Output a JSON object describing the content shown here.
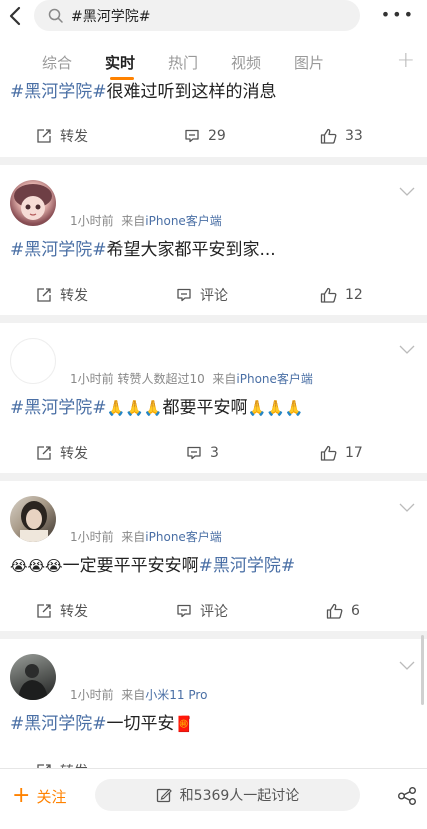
{
  "search": {
    "query": "#黑河学院#"
  },
  "tabs": [
    {
      "label": "综合"
    },
    {
      "label": "实时"
    },
    {
      "label": "热门"
    },
    {
      "label": "视频"
    },
    {
      "label": "图片"
    }
  ],
  "accent_color": "#ff8200",
  "tag_color": "#4a6fa5",
  "posts": [
    {
      "tag": "#黑河学院#",
      "text": "很难过听到这样的消息",
      "actions": {
        "repost": "转发",
        "comment": "29",
        "like": "33"
      }
    },
    {
      "avatar": "avatar-anime-girl",
      "time": "1小时前",
      "from": "来自",
      "source": "iPhone客户端",
      "tag": "#黑河学院#",
      "text": "希望大家都平安到家...",
      "actions": {
        "repost": "转发",
        "comment": "评论",
        "like": "12"
      }
    },
    {
      "avatar": "avatar-blank",
      "time": "1小时前",
      "extra": "转赞人数超过10",
      "from": "来自",
      "source": "iPhone客户端",
      "tag": "#黑河学院#",
      "prayers_before": "🙏🙏🙏",
      "text": "都要平安啊",
      "prayers_after": "🙏🙏🙏",
      "actions": {
        "repost": "转发",
        "comment": "3",
        "like": "17"
      }
    },
    {
      "avatar": "avatar-girl-photo",
      "time": "1小时前",
      "from": "来自",
      "source": "iPhone客户端",
      "crying": "😭😭😭",
      "text": "一定要平平安安啊",
      "tag": "#黑河学院#",
      "actions": {
        "repost": "转发",
        "comment": "评论",
        "like": "6"
      }
    },
    {
      "avatar": "avatar-man-photo",
      "time": "1小时前",
      "from": "来自",
      "source": "小米11 Pro",
      "tag": "#黑河学院#",
      "text": "一切平安",
      "emoji": "🧧",
      "actions": {
        "repost": "转发"
      }
    }
  ],
  "bottom": {
    "follow": "关注",
    "discuss": "和5369人一起讨论"
  }
}
